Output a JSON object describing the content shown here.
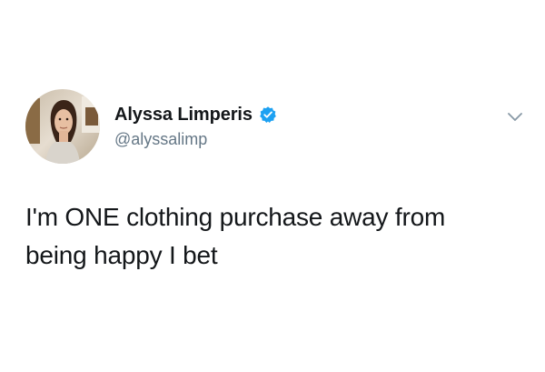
{
  "author": {
    "display_name": "Alyssa Limperis",
    "handle": "@alyssalimp",
    "verified": true
  },
  "tweet": {
    "text": "I'm ONE clothing purchase away from\nbeing happy I bet"
  },
  "icons": {
    "verified": "verified-badge-icon",
    "more": "chevron-down-icon"
  },
  "colors": {
    "verified_blue": "#1da1f2",
    "handle_gray": "#657786",
    "text_dark": "#14171a"
  }
}
